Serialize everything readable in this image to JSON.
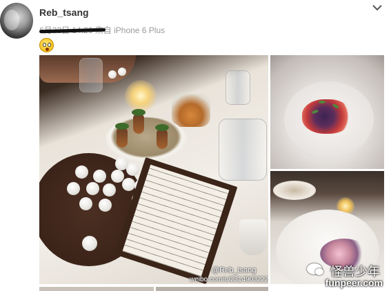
{
  "post": {
    "username": "Reb_tsang",
    "date": "6月22日 14:26",
    "source_prefix": "来自",
    "source_device": "iPhone 6 Plus",
    "emoji": "shocked-face-emoji"
  },
  "photos": [
    {
      "id": "photo-1",
      "watermark_handle": "@Reb_tsang",
      "watermark_url": "weibo.com/u/2314903222"
    },
    {
      "id": "photo-2"
    },
    {
      "id": "photo-3"
    }
  ],
  "branding": {
    "chinese_text": "怪兽少年",
    "site": "funpeer.com"
  },
  "icons": {
    "expand": "chevron-down-icon",
    "avatar": "avatar"
  },
  "colors": {
    "text_primary": "#333333",
    "text_meta": "#999999",
    "background": "#ffffff"
  }
}
